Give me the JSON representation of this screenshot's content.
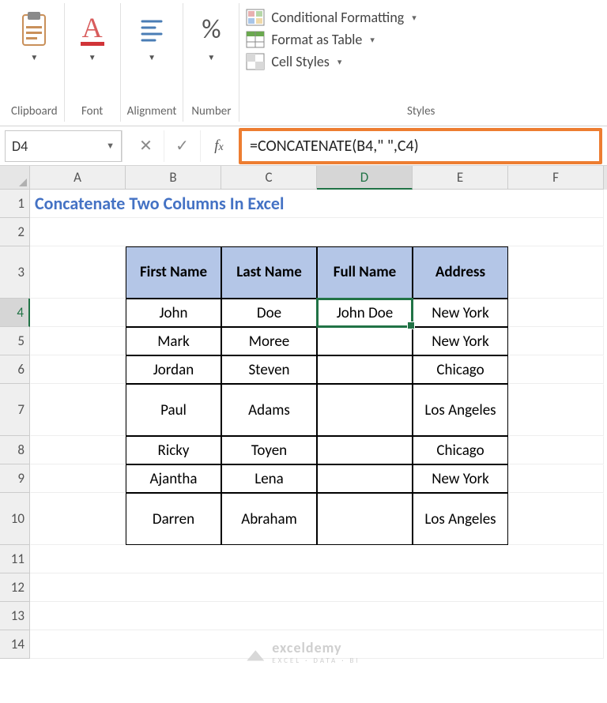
{
  "ribbon": {
    "clipboard": {
      "label": "Clipboard"
    },
    "font": {
      "label": "Font",
      "glyph": "A"
    },
    "alignment": {
      "label": "Alignment"
    },
    "number": {
      "label": "Number",
      "glyph": "%"
    },
    "styles": {
      "label": "Styles",
      "conditional": "Conditional Formatting",
      "table": "Format as Table",
      "cell": "Cell Styles"
    }
  },
  "formula_bar": {
    "name_box": "D4",
    "formula": "=CONCATENATE(B4,\" \",C4)"
  },
  "columns": [
    "A",
    "B",
    "C",
    "D",
    "E",
    "F"
  ],
  "active_col_idx": 3,
  "active_row": 4,
  "title": "Concatenate Two Columns In Excel",
  "headers": {
    "first": "First Name",
    "last": "Last Name",
    "full": "Full Name",
    "address": "Address"
  },
  "rows": [
    {
      "first": "John",
      "last": "Doe",
      "full": "John Doe",
      "address": "New York"
    },
    {
      "first": "Mark",
      "last": "Moree",
      "full": "",
      "address": "New York"
    },
    {
      "first": "Jordan",
      "last": "Steven",
      "full": "",
      "address": "Chicago"
    },
    {
      "first": "Paul",
      "last": "Adams",
      "full": "",
      "address": "Los Angeles"
    },
    {
      "first": "Ricky",
      "last": "Toyen",
      "full": "",
      "address": "Chicago"
    },
    {
      "first": "Ajantha",
      "last": "Lena",
      "full": "",
      "address": "New York"
    },
    {
      "first": "Darren",
      "last": "Abraham",
      "full": "",
      "address": "Los Angeles"
    }
  ],
  "watermark": {
    "name": "exceldemy",
    "tag": "EXCEL · DATA · BI"
  }
}
